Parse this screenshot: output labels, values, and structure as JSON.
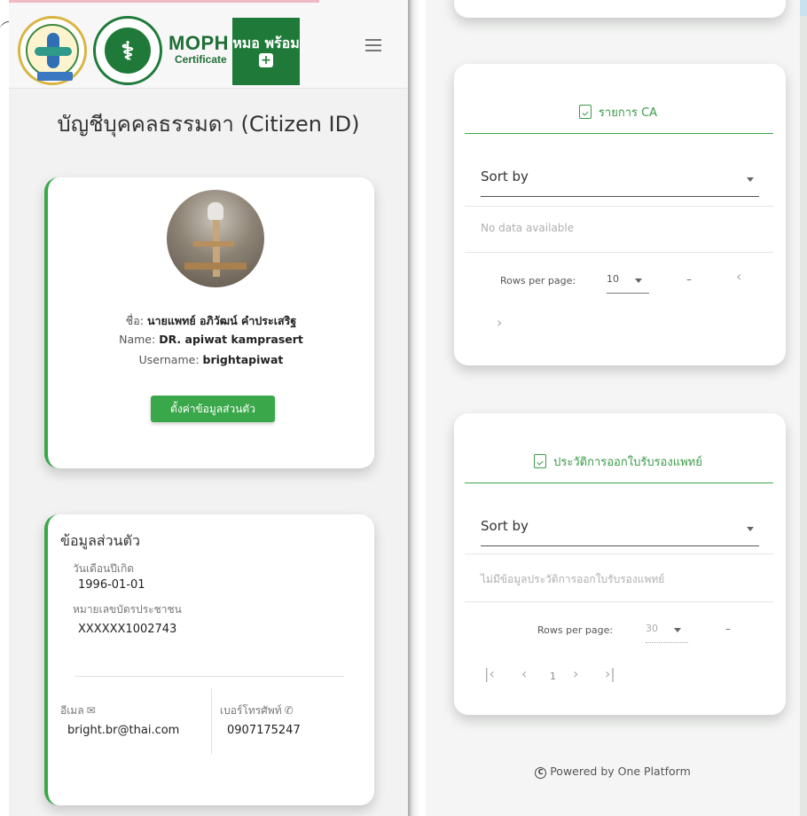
{
  "header": {
    "logos": {
      "seal_left_label": "",
      "moph_title": "MOPH",
      "moph_subtitle": "Certificate",
      "app_logo_text": "หมอ พร้อม",
      "app_logo_cross": "+"
    },
    "menu_icon": "hamburger-icon"
  },
  "page_title": "บัญชีบุคคลธรรมดา (Citizen ID)",
  "profile": {
    "thai_name_label": "ชื่อ:",
    "thai_name_value": "นายแพทย์ อภิวัฒน์ คำประเสริฐ",
    "name_label": "Name:",
    "name_value": "DR. apiwat kamprasert",
    "username_label": "Username:",
    "username_value": "brightapiwat",
    "settings_button": "ตั้งค่าข้อมูลส่วนตัว"
  },
  "personal_info": {
    "title": "ข้อมูลส่วนตัว",
    "birthdate_label": "วันเดือนปีเกิด",
    "birthdate_value": "1996-01-01",
    "citizen_id_label": "หมายเลขบัตรประชาชน",
    "citizen_id_value": "XXXXXX1002743",
    "email_label": "อีเมล",
    "email_icon": "mail-icon",
    "email_value": "bright.br@thai.com",
    "phone_label": "เบอร์โทรศัพท์",
    "phone_icon": "phone-icon",
    "phone_value": "0907175247"
  },
  "ca_list": {
    "title": "รายการ CA",
    "sort_label": "Sort by",
    "empty_text": "No data available",
    "rows_per_page_label": "Rows per page:",
    "rows_per_page_value": "10",
    "range_text": "–",
    "prev_icon": "‹",
    "next_icon": "›"
  },
  "cert_history": {
    "title": "ประวัติการออกใบรับรองแพทย์",
    "sort_label": "Sort by",
    "empty_text": "ไม่มีข้อมูลประวัติการออกใบรับรองแพทย์",
    "rows_per_page_label": "Rows per page:",
    "rows_per_page_value": "30",
    "range_text": "–",
    "first_icon": "|‹",
    "prev_icon": "‹",
    "page_number": "1",
    "next_icon": "›",
    "last_icon": "›|"
  },
  "footer": {
    "text": "Powered by One Platform",
    "copyright_symbol": "C"
  }
}
